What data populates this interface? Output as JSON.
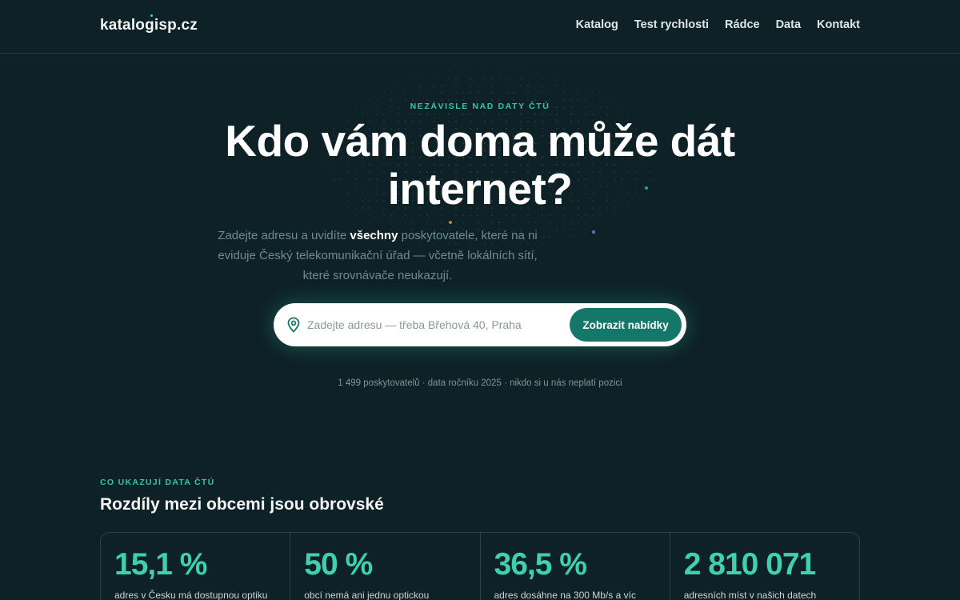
{
  "header": {
    "logo": "katalogisp.cz",
    "nav": [
      {
        "label": "Katalog"
      },
      {
        "label": "Test rychlosti"
      },
      {
        "label": "Rádce"
      },
      {
        "label": "Data"
      },
      {
        "label": "Kontakt"
      }
    ]
  },
  "hero": {
    "eyebrow": "NEZÁVISLE NAD DATY ČTÚ",
    "title": "Kdo vám doma může dát internet?",
    "subtitle_before": "Zadejte adresu a uvidíte ",
    "subtitle_bold": "všechny",
    "subtitle_after": " poskytovatele, které na ni eviduje Český telekomunikační úřad — včetně lokálních sítí, které srovnávače neukazují.",
    "search": {
      "icon": "location-pin-icon",
      "placeholder": "Zadejte adresu — třeba Břehová 40, Praha",
      "value": "",
      "button": "Zobrazit nabídky"
    },
    "meta": "1 499 poskytovatelů · data ročníku 2025 · nikdo si u nás neplatí pozici"
  },
  "stats_section": {
    "eyebrow": "CO UKAZUJÍ DATA ČTÚ",
    "title": "Rozdíly mezi obcemi jsou obrovské",
    "stats": [
      {
        "value": "15,1 %",
        "label": "adres v Česku má dostupnou optiku"
      },
      {
        "value": "50 %",
        "label": "obcí nemá ani jednu optickou"
      },
      {
        "value": "36,5 %",
        "label": "adres dosáhne na 300 Mb/s a víc"
      },
      {
        "value": "2 810 071",
        "label": "adresních míst v našich datech"
      }
    ]
  },
  "colors": {
    "background": "#0e2126",
    "accent": "#2fc7a4",
    "button": "#15776a"
  }
}
